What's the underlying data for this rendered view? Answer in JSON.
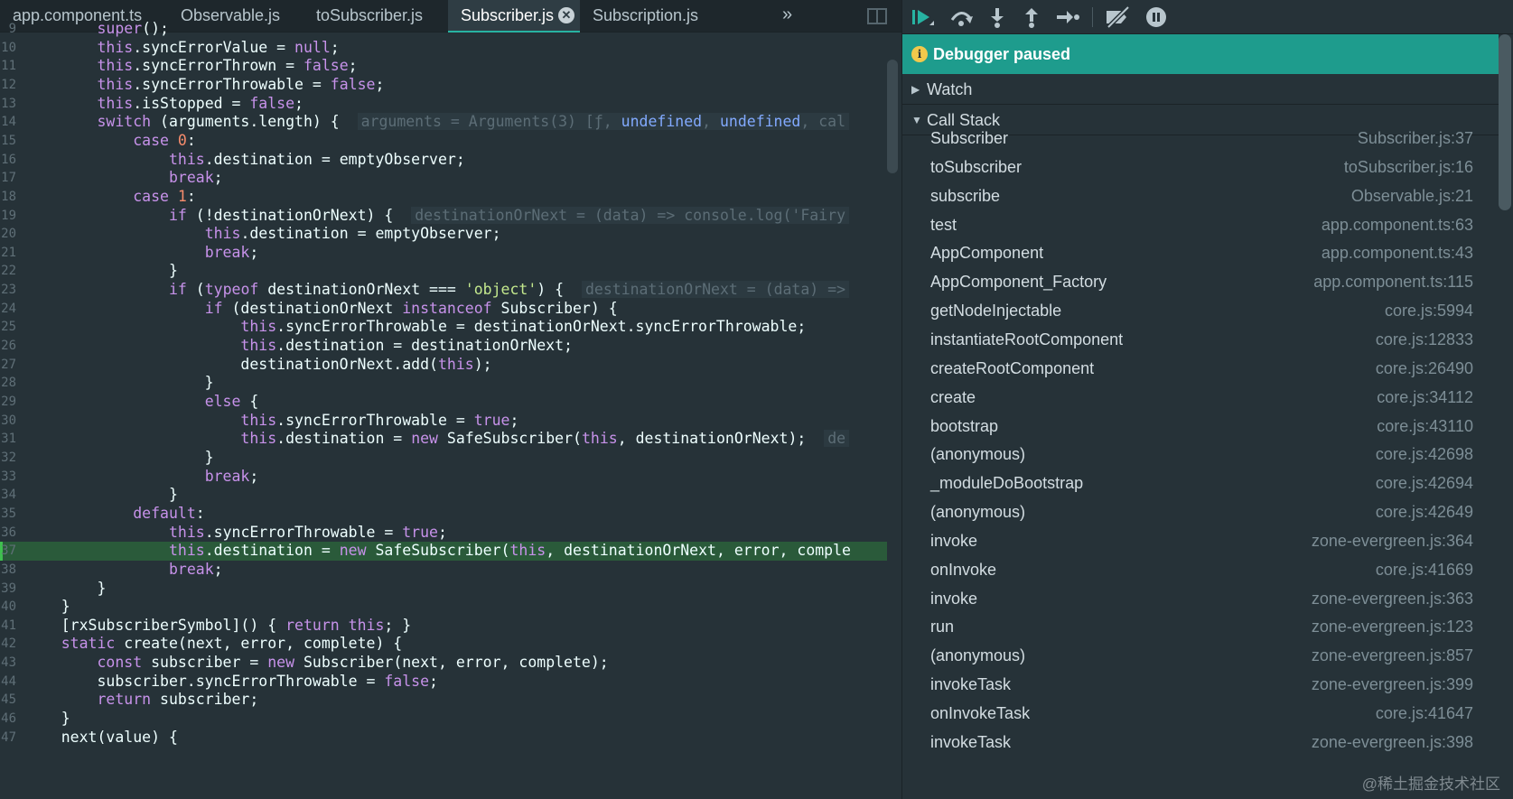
{
  "tabs": [
    {
      "label": "app.component.ts"
    },
    {
      "label": "Observable.js"
    },
    {
      "label": "toSubscriber.js"
    },
    {
      "label": "Subscriber.js",
      "active": true
    },
    {
      "label": "Subscription.js"
    }
  ],
  "tab_overflow": "»",
  "code_lines": [
    {
      "n": "9",
      "html": "        <span class='kw'>super</span>();"
    },
    {
      "n": "10",
      "html": "        <span class='kw'>this</span>.syncErrorValue = <span class='kw'>null</span>;"
    },
    {
      "n": "11",
      "html": "        <span class='kw'>this</span>.syncErrorThrown = <span class='kw'>false</span>;"
    },
    {
      "n": "12",
      "html": "        <span class='kw'>this</span>.syncErrorThrowable = <span class='kw'>false</span>;"
    },
    {
      "n": "13",
      "html": "        <span class='kw'>this</span>.isStopped = <span class='kw'>false</span>;"
    },
    {
      "n": "14",
      "html": "        <span class='kw'>switch</span> (arguments.length) {  <span class='inl'>arguments = Arguments(3) [ƒ, <span class='ik'>undefined</span>, <span class='ik'>undefined</span>, cal</span>"
    },
    {
      "n": "15",
      "html": "            <span class='kw'>case</span> <span class='num'>0</span>:"
    },
    {
      "n": "16",
      "html": "                <span class='kw'>this</span>.destination = emptyObserver;"
    },
    {
      "n": "17",
      "html": "                <span class='kw'>break</span>;"
    },
    {
      "n": "18",
      "html": "            <span class='kw'>case</span> <span class='num'>1</span>:"
    },
    {
      "n": "19",
      "html": "                <span class='kw'>if</span> (!destinationOrNext) {  <span class='inl'>destinationOrNext = (data) =&gt; console.log('Fairy</span>"
    },
    {
      "n": "20",
      "html": "                    <span class='kw'>this</span>.destination = emptyObserver;"
    },
    {
      "n": "21",
      "html": "                    <span class='kw'>break</span>;"
    },
    {
      "n": "22",
      "html": "                }"
    },
    {
      "n": "23",
      "html": "                <span class='kw'>if</span> (<span class='kw'>typeof</span> destinationOrNext === <span class='str'>'object'</span>) {  <span class='inl'>destinationOrNext = (data) =&gt;</span>"
    },
    {
      "n": "24",
      "html": "                    <span class='kw'>if</span> (destinationOrNext <span class='kw'>instanceof</span> Subscriber) {"
    },
    {
      "n": "25",
      "html": "                        <span class='kw'>this</span>.syncErrorThrowable = destinationOrNext.syncErrorThrowable;"
    },
    {
      "n": "26",
      "html": "                        <span class='kw'>this</span>.destination = destinationOrNext;"
    },
    {
      "n": "27",
      "html": "                        destinationOrNext.add(<span class='kw'>this</span>);"
    },
    {
      "n": "28",
      "html": "                    }"
    },
    {
      "n": "29",
      "html": "                    <span class='kw'>else</span> {"
    },
    {
      "n": "30",
      "html": "                        <span class='kw'>this</span>.syncErrorThrowable = <span class='kw'>true</span>;"
    },
    {
      "n": "31",
      "html": "                        <span class='kw'>this</span>.destination = <span class='kw'>new</span> SafeSubscriber(<span class='kw'>this</span>, destinationOrNext);  <span class='inl'>de</span>"
    },
    {
      "n": "32",
      "html": "                    }"
    },
    {
      "n": "33",
      "html": "                    <span class='kw'>break</span>;"
    },
    {
      "n": "34",
      "html": "                }"
    },
    {
      "n": "35",
      "html": "            <span class='kw'>default</span>:"
    },
    {
      "n": "36",
      "html": "                <span class='kw'>this</span>.syncErrorThrowable = <span class='kw'>true</span>;"
    },
    {
      "n": "37",
      "current": true,
      "html": "                <span class='kw'>this</span>.destination = <span class='kw'>new</span> SafeSubscriber(<span class='kw'>this</span>, destinationOrNext, error, comple"
    },
    {
      "n": "38",
      "html": "                <span class='kw'>break</span>;"
    },
    {
      "n": "39",
      "html": "        }"
    },
    {
      "n": "40",
      "html": "    }"
    },
    {
      "n": "41",
      "html": "    [rxSubscriberSymbol]() { <span class='kw'>return</span> <span class='kw'>this</span>; }"
    },
    {
      "n": "42",
      "html": "    <span class='kw'>static</span> create(next, error, complete) {"
    },
    {
      "n": "43",
      "html": "        <span class='kw'>const</span> subscriber = <span class='kw'>new</span> Subscriber(next, error, complete);"
    },
    {
      "n": "44",
      "html": "        subscriber.syncErrorThrowable = <span class='kw'>false</span>;"
    },
    {
      "n": "45",
      "html": "        <span class='kw'>return</span> subscriber;"
    },
    {
      "n": "46",
      "html": "    }"
    },
    {
      "n": "47",
      "html": "    next(value) {"
    }
  ],
  "debugger": {
    "paused_icon": "i",
    "paused_text": "Debugger paused",
    "watch_label": "Watch",
    "callstack_label": "Call Stack",
    "frames": [
      {
        "fn": "Subscriber",
        "loc": "Subscriber.js:37"
      },
      {
        "fn": "toSubscriber",
        "loc": "toSubscriber.js:16"
      },
      {
        "fn": "subscribe",
        "loc": "Observable.js:21"
      },
      {
        "fn": "test",
        "loc": "app.component.ts:63"
      },
      {
        "fn": "AppComponent",
        "loc": "app.component.ts:43"
      },
      {
        "fn": "AppComponent_Factory",
        "loc": "app.component.ts:115"
      },
      {
        "fn": "getNodeInjectable",
        "loc": "core.js:5994"
      },
      {
        "fn": "instantiateRootComponent",
        "loc": "core.js:12833"
      },
      {
        "fn": "createRootComponent",
        "loc": "core.js:26490"
      },
      {
        "fn": "create",
        "loc": "core.js:34112"
      },
      {
        "fn": "bootstrap",
        "loc": "core.js:43110"
      },
      {
        "fn": "(anonymous)",
        "loc": "core.js:42698"
      },
      {
        "fn": "_moduleDoBootstrap",
        "loc": "core.js:42694"
      },
      {
        "fn": "(anonymous)",
        "loc": "core.js:42649"
      },
      {
        "fn": "invoke",
        "loc": "zone-evergreen.js:364"
      },
      {
        "fn": "onInvoke",
        "loc": "core.js:41669"
      },
      {
        "fn": "invoke",
        "loc": "zone-evergreen.js:363"
      },
      {
        "fn": "run",
        "loc": "zone-evergreen.js:123"
      },
      {
        "fn": "(anonymous)",
        "loc": "zone-evergreen.js:857"
      },
      {
        "fn": "invokeTask",
        "loc": "zone-evergreen.js:399"
      },
      {
        "fn": "onInvokeTask",
        "loc": "core.js:41647"
      },
      {
        "fn": "invokeTask",
        "loc": "zone-evergreen.js:398"
      }
    ]
  },
  "toolbar_icons": [
    "resume-icon",
    "step-over-icon",
    "step-into-icon",
    "step-out-icon",
    "step-icon",
    "deactivate-breakpoints-icon",
    "pause-on-exceptions-icon"
  ],
  "watermark": "@稀土掘金技术社区",
  "colors": {
    "accent": "#1e9c8d",
    "current_line": "#2a5a3a",
    "background": "#263238"
  }
}
